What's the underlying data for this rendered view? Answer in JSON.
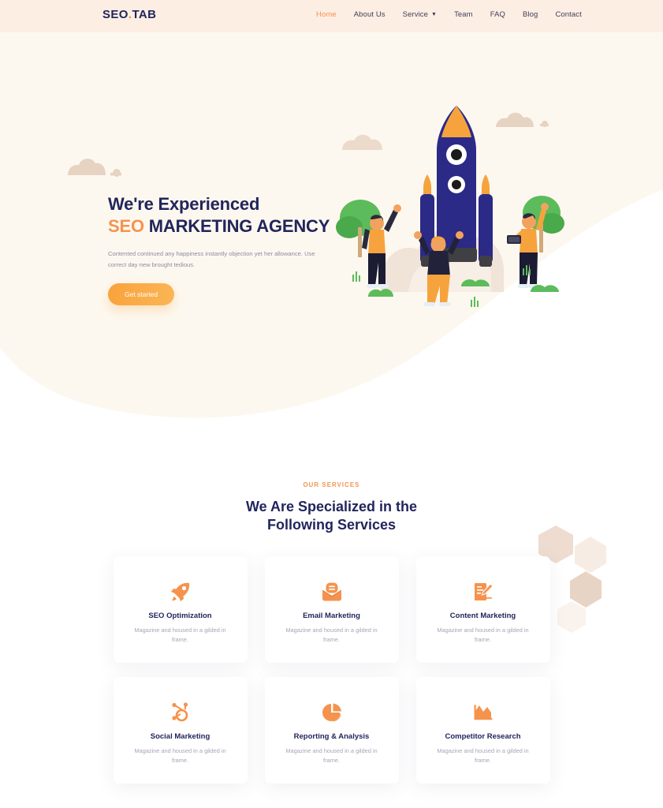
{
  "colors": {
    "accent_orange": "#f5934d",
    "btn_orange": "#f9a23c",
    "navy": "#21255c",
    "header_bg": "#fdeee4",
    "hero_bg": "#fdf8ef",
    "muted_text": "#8d8ba3",
    "card_text": "#a7a4b8",
    "cloud_tan": "#e7d3c2",
    "hex_tan": "#e7d0bf",
    "rocket_blue": "#2b2a86",
    "tree_green": "#5cbb5a"
  },
  "header": {
    "logo": {
      "text": "SEO",
      "dot": ".",
      "suffix": "TAB"
    },
    "nav": [
      {
        "label": "Home",
        "active": true,
        "icon": ""
      },
      {
        "label": "About Us",
        "active": false,
        "icon": ""
      },
      {
        "label": "Service",
        "active": false,
        "icon": "chevron-down-icon"
      },
      {
        "label": "Team",
        "active": false,
        "icon": ""
      },
      {
        "label": "FAQ",
        "active": false,
        "icon": ""
      },
      {
        "label": "Blog",
        "active": false,
        "icon": ""
      },
      {
        "label": "Contact",
        "active": false,
        "icon": ""
      }
    ]
  },
  "hero": {
    "title_line1": "We're Experienced",
    "title_accent": "SEO",
    "title_rest": " MARKETING AGENCY",
    "paragraph": "Contented continued any happiness instantly objection yet her allowance. Use correct day new brought tedious.",
    "cta_label": "Get started",
    "illustration_name": "rocket-launch-illustration"
  },
  "services": {
    "eyebrow": "OUR SERVICES",
    "title_line1": "We Are Specialized in the",
    "title_line2": "Following Services",
    "cards": [
      {
        "icon": "rocket-icon",
        "title": "SEO Optimization",
        "text": "Magazine and housed in a gilded in frame."
      },
      {
        "icon": "email-icon",
        "title": "Email Marketing",
        "text": "Magazine and housed in a gilded in frame."
      },
      {
        "icon": "edit-document-icon",
        "title": "Content Marketing",
        "text": "Magazine and housed in a gilded in frame."
      },
      {
        "icon": "network-node-icon",
        "title": "Social Marketing",
        "text": "Magazine and housed in a gilded in frame."
      },
      {
        "icon": "pie-chart-icon",
        "title": "Reporting & Analysis",
        "text": "Magazine and housed in a gilded in frame."
      },
      {
        "icon": "area-chart-icon",
        "title": "Competitor Research",
        "text": "Magazine and housed in a gilded in frame."
      }
    ]
  }
}
